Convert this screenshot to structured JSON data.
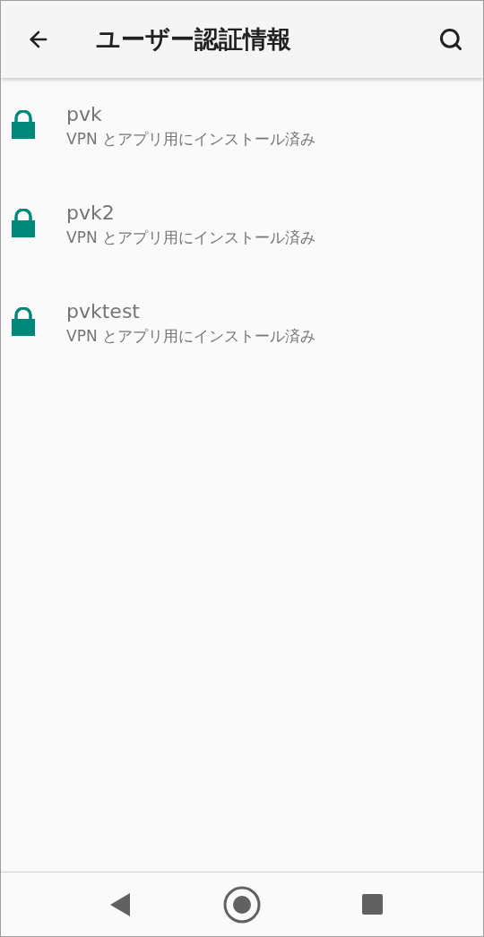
{
  "app_bar": {
    "title": "ユーザー認証情報"
  },
  "credentials": [
    {
      "name": "pvk",
      "description": "VPN とアプリ用にインストール済み"
    },
    {
      "name": "pvk2",
      "description": "VPN とアプリ用にインストール済み"
    },
    {
      "name": "pvktest",
      "description": "VPN とアプリ用にインストール済み"
    }
  ]
}
